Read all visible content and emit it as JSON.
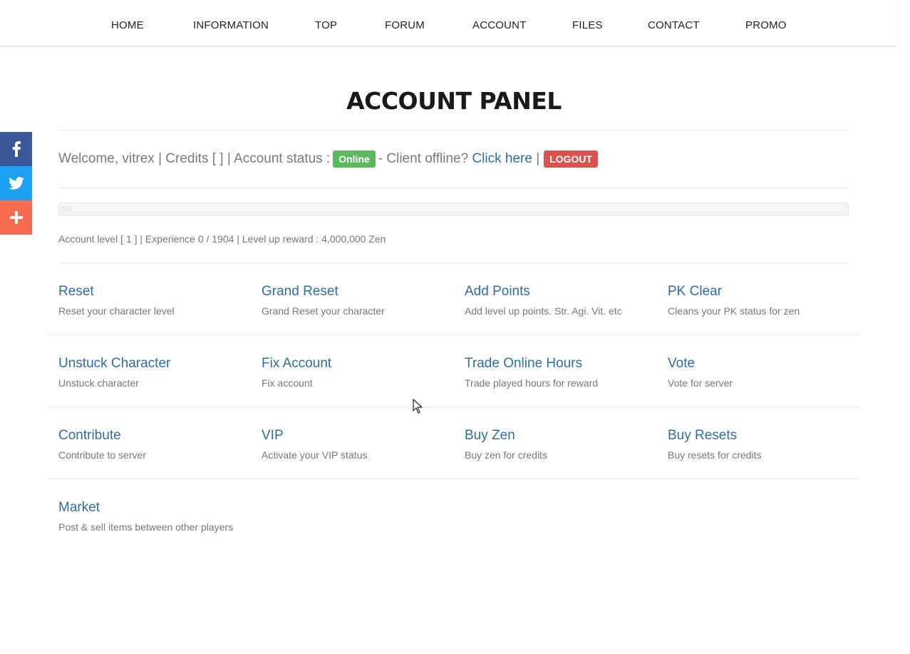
{
  "nav": {
    "items": [
      "HOME",
      "INFORMATION",
      "TOP",
      "FORUM",
      "ACCOUNT",
      "FILES",
      "CONTACT",
      "PROMO"
    ]
  },
  "social": [
    {
      "icon": "facebook-icon",
      "color": "#3b5998"
    },
    {
      "icon": "twitter-icon",
      "color": "#1da1f2"
    },
    {
      "icon": "plus-icon",
      "color": "#f76b4f"
    }
  ],
  "page": {
    "title": "ACCOUNT PANEL"
  },
  "welcome": {
    "text": "Welcome, vitrex | Credits [ ] | Account status :",
    "status": "Online",
    "client_text": "- Client offline?",
    "click_here": "Click here",
    "separator": "|",
    "logout": "LOGOUT"
  },
  "progress": {
    "percent": 0,
    "label": "0%"
  },
  "level_info": "Account level [ 1 ] | Experience 0 / 1904 | Level up reward : 4,000,000 Zen",
  "features": [
    {
      "title": "Reset",
      "desc": "Reset your character level"
    },
    {
      "title": "Grand Reset",
      "desc": "Grand Reset your character"
    },
    {
      "title": "Add Points",
      "desc": "Add level up points. Str. Agi. Vit. etc"
    },
    {
      "title": "PK Clear",
      "desc": "Cleans your PK status for zen"
    },
    {
      "title": "Unstuck Character",
      "desc": "Unstuck character"
    },
    {
      "title": "Fix Account",
      "desc": "Fix account"
    },
    {
      "title": "Trade Online Hours",
      "desc": "Trade played hours for reward"
    },
    {
      "title": "Vote",
      "desc": "Vote for server"
    },
    {
      "title": "Contribute",
      "desc": "Contribute to server"
    },
    {
      "title": "VIP",
      "desc": "Activate your VIP status"
    },
    {
      "title": "Buy Zen",
      "desc": "Buy zen for credits"
    },
    {
      "title": "Buy Resets",
      "desc": "Buy resets for credits"
    },
    {
      "title": "Market",
      "desc": "Post & sell items between other players"
    }
  ],
  "colors": {
    "link": "#2e6da4",
    "online": "#5cb85c",
    "logout": "#d9534f"
  }
}
